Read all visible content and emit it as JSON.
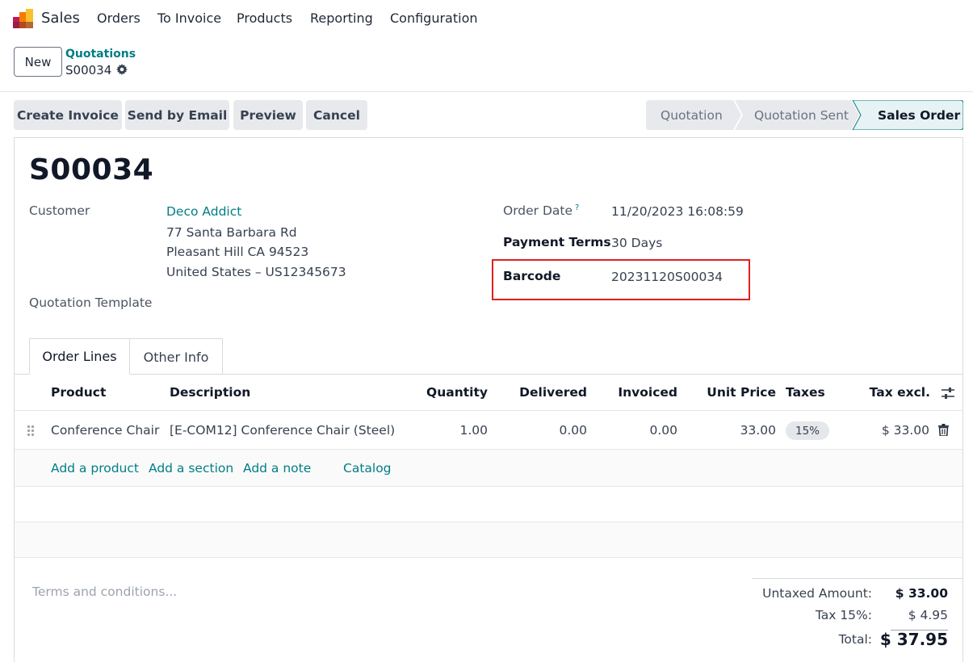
{
  "navbar": {
    "app_name": "Sales",
    "menus": [
      "Orders",
      "To Invoice",
      "Products",
      "Reporting",
      "Configuration"
    ]
  },
  "control_panel": {
    "new_label": "New",
    "breadcrumb_parent": "Quotations",
    "breadcrumb_current": "S00034"
  },
  "actions": [
    "Create Invoice",
    "Send by Email",
    "Preview",
    "Cancel"
  ],
  "statusbar": {
    "stages": [
      "Quotation",
      "Quotation Sent",
      "Sales Order"
    ],
    "active": "Sales Order"
  },
  "record": {
    "title": "S00034",
    "customer_label": "Customer",
    "customer_name": "Deco Addict",
    "address_line1": "77 Santa Barbara Rd",
    "address_line2": "Pleasant Hill CA 94523",
    "address_line3": "United States – US12345673",
    "template_label": "Quotation Template",
    "order_date_label": "Order Date",
    "order_date_tip": "?",
    "order_date": "11/20/2023 16:08:59",
    "payment_terms_label": "Payment Terms",
    "payment_terms": "30 Days",
    "barcode_label": "Barcode",
    "barcode": "20231120S00034"
  },
  "tabs": [
    "Order Lines",
    "Other Info"
  ],
  "table": {
    "columns": [
      "Product",
      "Description",
      "Quantity",
      "Delivered",
      "Invoiced",
      "Unit Price",
      "Taxes",
      "Tax excl."
    ],
    "rows": [
      {
        "product": "Conference Chair",
        "description": "[E-COM12] Conference Chair (Steel)",
        "quantity": "1.00",
        "delivered": "0.00",
        "invoiced": "0.00",
        "unit_price": "33.00",
        "taxes": "15%",
        "subtotal": "$ 33.00"
      }
    ],
    "add_links": [
      "Add a product",
      "Add a section",
      "Add a note",
      "Catalog"
    ]
  },
  "terms_placeholder": "Terms and conditions...",
  "totals": {
    "untaxed_label": "Untaxed Amount:",
    "untaxed": "$ 33.00",
    "tax_label": "Tax 15%:",
    "tax": "$ 4.95",
    "total_label": "Total:",
    "total": "$ 37.95"
  },
  "colors": {
    "accent": "#017e84",
    "highlight": "#e02020",
    "active_stage_bg": "#e6f2f3"
  }
}
